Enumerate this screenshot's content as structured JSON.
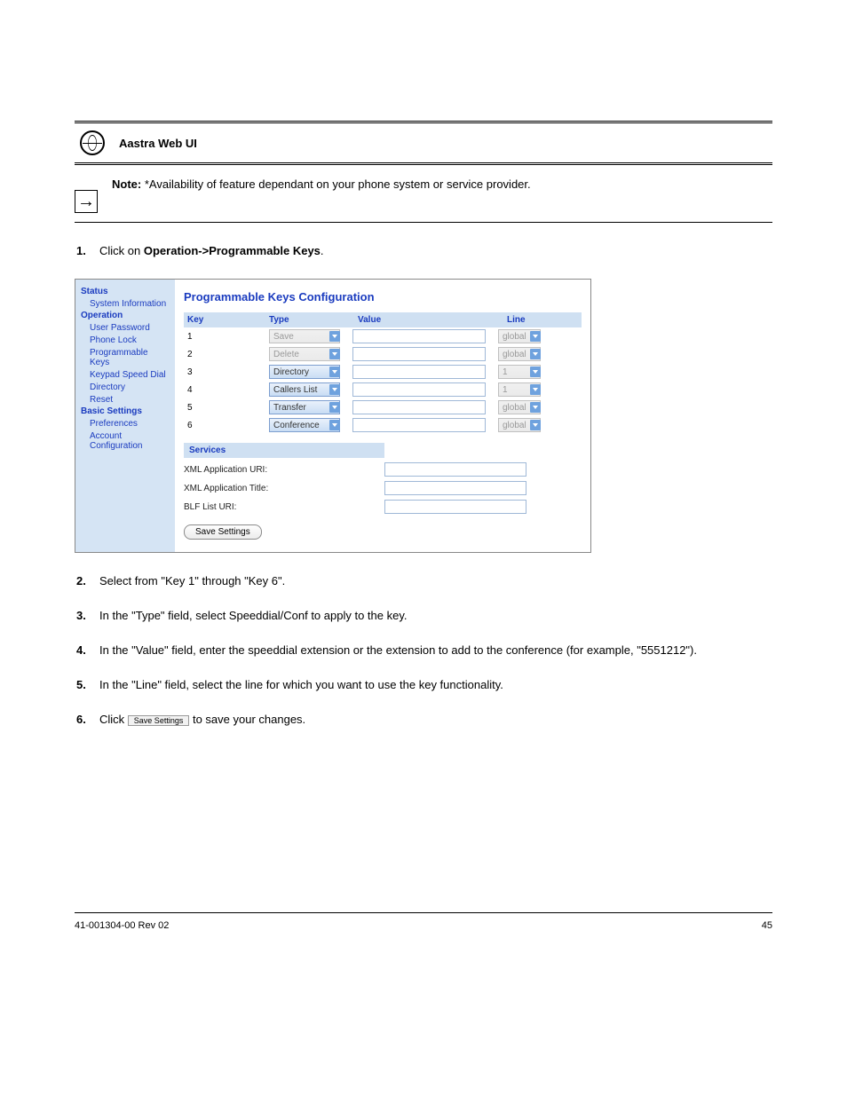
{
  "icon_band": {
    "aastra_web_ui": "Aastra Web UI"
  },
  "note": {
    "bold": "Note:",
    "text": "*Availability of feature dependant on your phone system or service provider."
  },
  "steps": {
    "s1_pre": "Click on",
    "s1_bold": "Operation->Programmable Keys",
    "s1_post": ".",
    "s2": "Select from \"Key 1\" through \"Key 6\".",
    "s3": "In the \"Type\" field, select Speeddial/Conf to apply to the key.",
    "s4": "In the \"Value\" field, enter the speeddial extension or the extension to add to the conference (for example, \"5551212\").",
    "s5": "In the \"Line\" field, select the line for which you want to use the key functionality.",
    "s6": "Click",
    "s6_post": "to save your changes."
  },
  "tinybtn_label": "Save Settings",
  "shot": {
    "title": "Programmable Keys Configuration",
    "sidebar": {
      "status": "Status",
      "system_info": "System Information",
      "operation": "Operation",
      "user_password": "User Password",
      "phone_lock": "Phone Lock",
      "prog_keys": "Programmable Keys",
      "keypad_speed": "Keypad Speed Dial",
      "directory": "Directory",
      "reset": "Reset",
      "basic_settings": "Basic Settings",
      "preferences": "Preferences",
      "account_config": "Account Configuration"
    },
    "columns": {
      "key": "Key",
      "type": "Type",
      "value": "Value",
      "line": "Line"
    },
    "rows": [
      {
        "key": "1",
        "type": "Save",
        "type_disabled": true,
        "value": "",
        "line": "global",
        "line_disabled": true
      },
      {
        "key": "2",
        "type": "Delete",
        "type_disabled": true,
        "value": "",
        "line": "global",
        "line_disabled": true
      },
      {
        "key": "3",
        "type": "Directory",
        "type_disabled": false,
        "value": "",
        "line": "1",
        "line_disabled": true
      },
      {
        "key": "4",
        "type": "Callers List",
        "type_disabled": false,
        "value": "",
        "line": "1",
        "line_disabled": true
      },
      {
        "key": "5",
        "type": "Transfer",
        "type_disabled": false,
        "value": "",
        "line": "global",
        "line_disabled": true
      },
      {
        "key": "6",
        "type": "Conference",
        "type_disabled": false,
        "value": "",
        "line": "global",
        "line_disabled": true
      }
    ],
    "services": {
      "header": "Services",
      "xml_uri": "XML Application URI:",
      "xml_title": "XML Application Title:",
      "blf_uri": "BLF List URI:"
    },
    "save_btn": "Save Settings"
  },
  "footer": {
    "left": "41-001304-00 Rev 02",
    "right": "45"
  }
}
